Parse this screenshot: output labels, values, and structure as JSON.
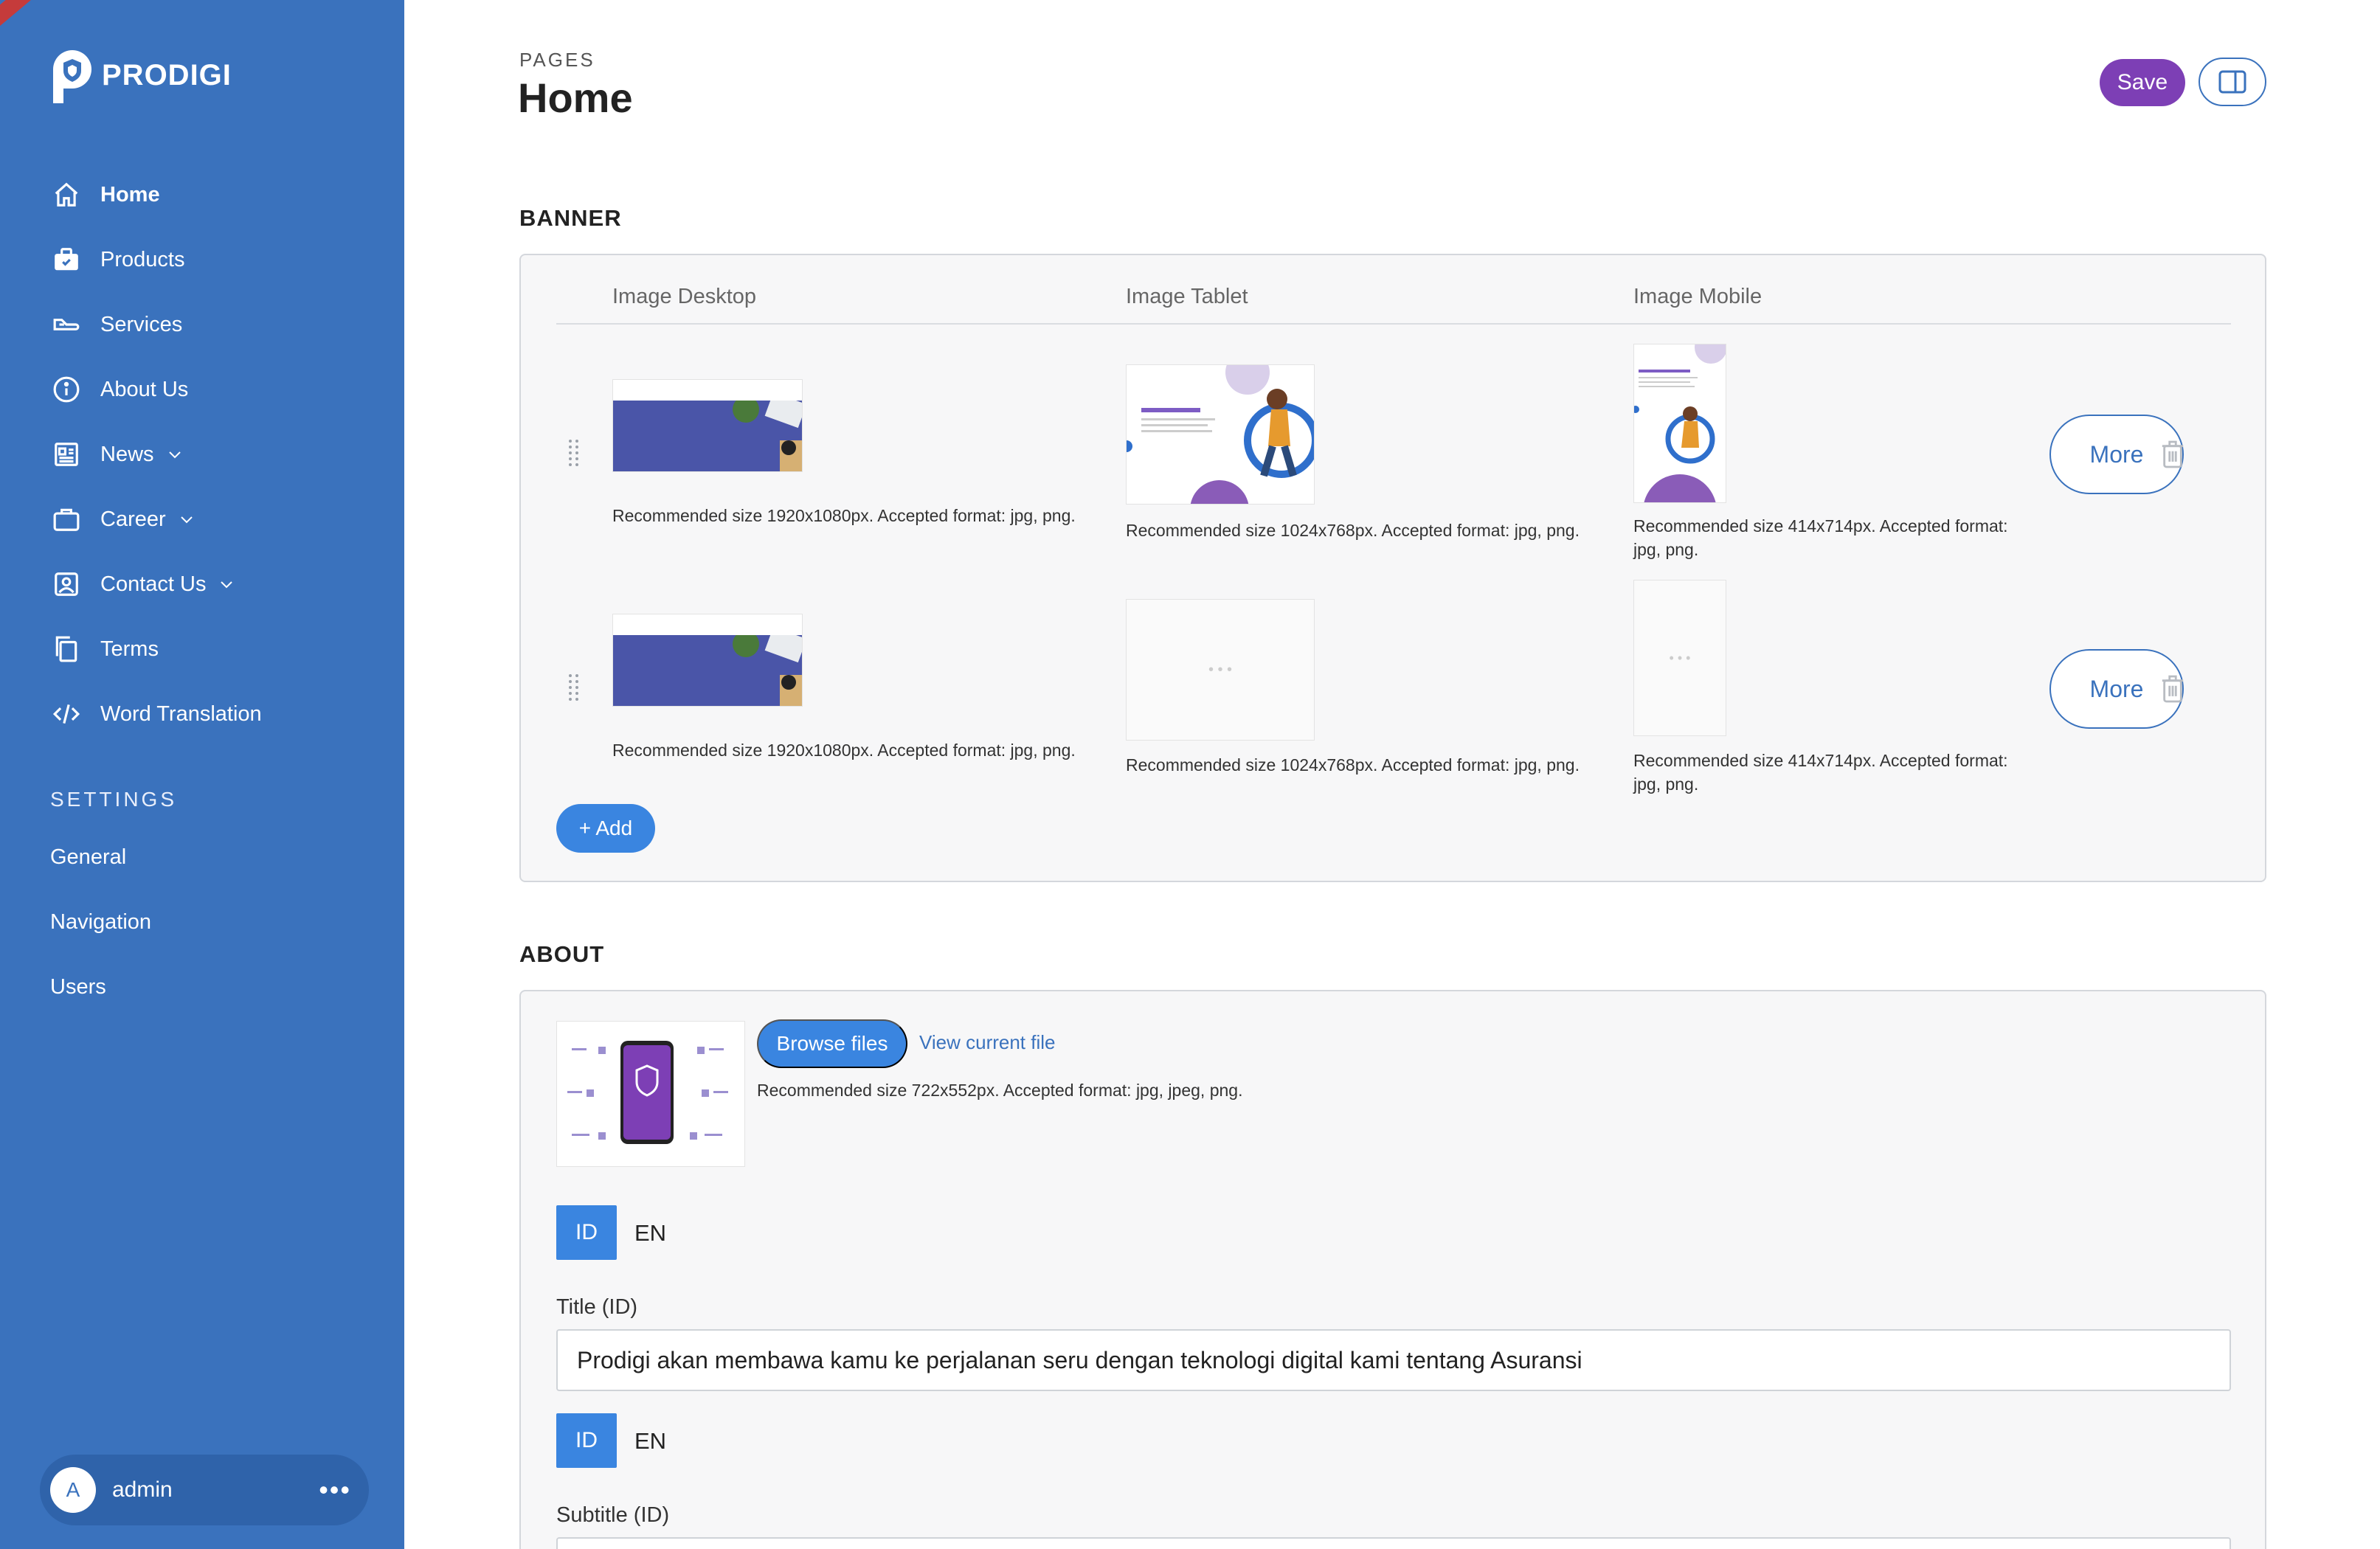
{
  "brand": {
    "name": "PRODIGI"
  },
  "sidebar": {
    "items": [
      {
        "label": "Home",
        "icon": "home-icon"
      },
      {
        "label": "Products",
        "icon": "briefcase-icon"
      },
      {
        "label": "Services",
        "icon": "services-icon"
      },
      {
        "label": "About Us",
        "icon": "info-icon"
      },
      {
        "label": "News",
        "icon": "newspaper-icon"
      },
      {
        "label": "Career",
        "icon": "bag-icon"
      },
      {
        "label": "Contact Us",
        "icon": "contact-icon"
      },
      {
        "label": "Terms",
        "icon": "document-icon"
      },
      {
        "label": "Word Translation",
        "icon": "code-icon"
      }
    ],
    "settings_heading": "SETTINGS",
    "settings_items": [
      {
        "label": "General"
      },
      {
        "label": "Navigation"
      },
      {
        "label": "Users"
      }
    ],
    "user": {
      "initial": "A",
      "name": "admin",
      "more": "•••"
    }
  },
  "header": {
    "breadcrumb": "PAGES",
    "title": "Home",
    "save_label": "Save"
  },
  "banner": {
    "section_title": "BANNER",
    "columns": [
      "Image Desktop",
      "Image Tablet",
      "Image Mobile"
    ],
    "rows": [
      {
        "desktop_hint": "Recommended size 1920x1080px. Accepted format: jpg, png.",
        "tablet_hint": "Recommended size 1024x768px. Accepted format: jpg, png.",
        "mobile_hint_line1": "Recommended size 414x714px. Accepted format:",
        "mobile_hint_line2": "jpg, png.",
        "more_label": "More"
      },
      {
        "desktop_hint": "Recommended size 1920x1080px. Accepted format: jpg, png.",
        "tablet_hint": "Recommended size 1024x768px. Accepted format: jpg, png.",
        "mobile_hint_line1": "Recommended size 414x714px. Accepted format:",
        "mobile_hint_line2": "jpg, png.",
        "more_label": "More"
      }
    ],
    "add_label": "+ Add",
    "placeholder_dots": "• • •"
  },
  "about": {
    "section_title": "ABOUT",
    "browse_label": "Browse files",
    "view_link": "View current file",
    "image_hint": "Recommended size 722x552px. Accepted format: jpg, jpeg, png.",
    "lang_id": "ID",
    "lang_en": "EN",
    "title_label": "Title (ID)",
    "title_value": "Prodigi akan membawa kamu ke perjalanan seru dengan teknologi digital kami tentang Asuransi",
    "subtitle_label": "Subtitle (ID)"
  },
  "colors": {
    "sidebar": "#3a72bd",
    "accent": "#3a85e0",
    "save": "#7d3fb5"
  }
}
